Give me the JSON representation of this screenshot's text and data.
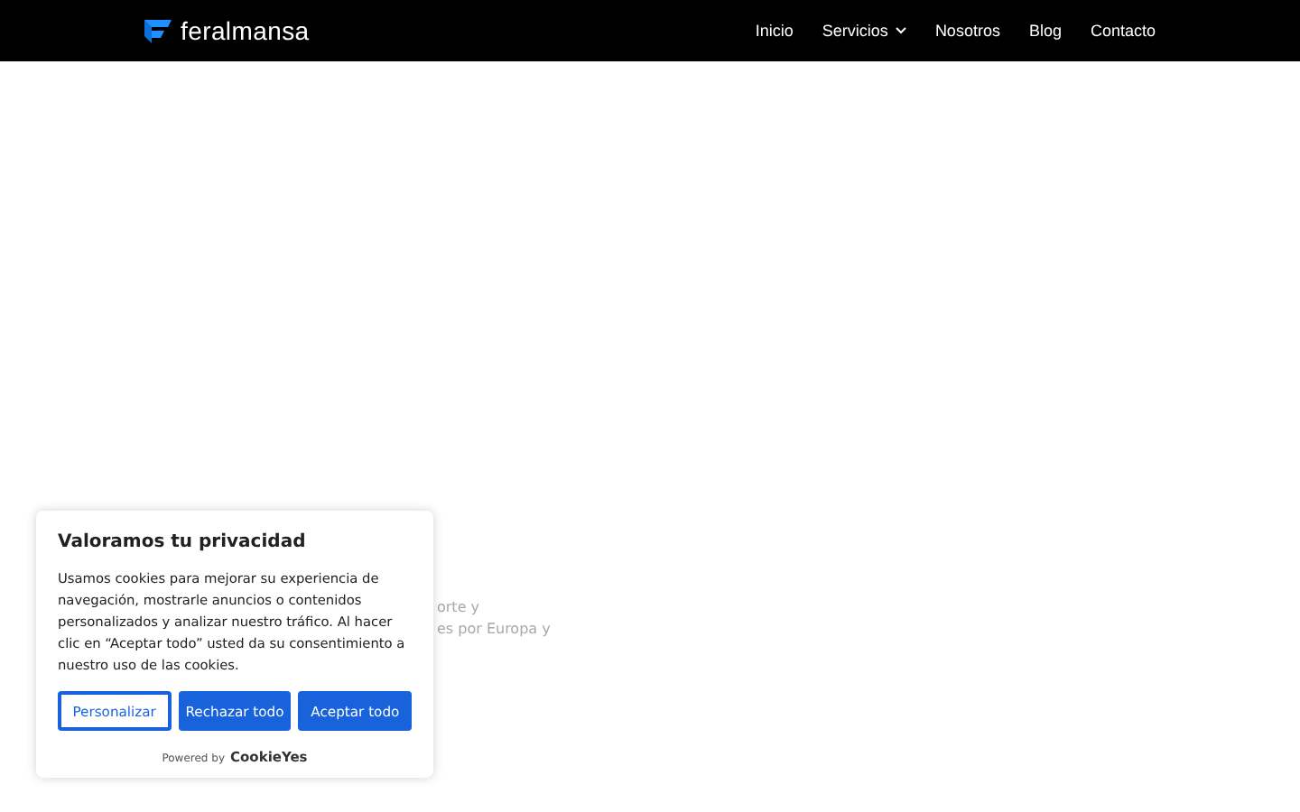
{
  "header": {
    "logo": "feralmansa",
    "nav": [
      {
        "label": "Inicio",
        "dropdown": false
      },
      {
        "label": "Servicios",
        "dropdown": true
      },
      {
        "label": "Nosotros",
        "dropdown": false
      },
      {
        "label": "Blog",
        "dropdown": false
      },
      {
        "label": "Contacto",
        "dropdown": false
      }
    ]
  },
  "background_text": [
    "orte y",
    "es por Europa y"
  ],
  "cookie_banner": {
    "title": "Valoramos tu privacidad",
    "message": "Usamos cookies para mejorar su experiencia de navegación, mostrarle anuncios o contenidos personalizados y analizar nuestro tráfico. Al hacer clic en “Aceptar todo” usted da su consentimiento a nuestro uso de las cookies.",
    "buttons": [
      {
        "label": "Personalizar",
        "kind": "outline"
      },
      {
        "label": "Rechazar todo",
        "kind": "filled"
      },
      {
        "label": "Aceptar todo",
        "kind": "filled"
      }
    ],
    "powered_by": "Powered by",
    "brand": "CookieYes"
  }
}
